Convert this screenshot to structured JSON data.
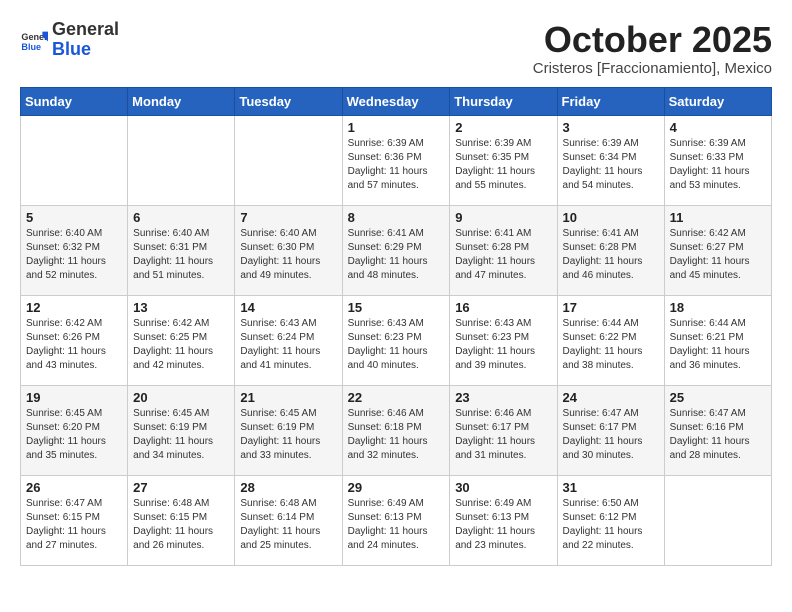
{
  "header": {
    "logo_general": "General",
    "logo_blue": "Blue",
    "month": "October 2025",
    "location": "Cristeros [Fraccionamiento], Mexico"
  },
  "days_of_week": [
    "Sunday",
    "Monday",
    "Tuesday",
    "Wednesday",
    "Thursday",
    "Friday",
    "Saturday"
  ],
  "weeks": [
    [
      {
        "day": "",
        "info": ""
      },
      {
        "day": "",
        "info": ""
      },
      {
        "day": "",
        "info": ""
      },
      {
        "day": "1",
        "info": "Sunrise: 6:39 AM\nSunset: 6:36 PM\nDaylight: 11 hours and 57 minutes."
      },
      {
        "day": "2",
        "info": "Sunrise: 6:39 AM\nSunset: 6:35 PM\nDaylight: 11 hours and 55 minutes."
      },
      {
        "day": "3",
        "info": "Sunrise: 6:39 AM\nSunset: 6:34 PM\nDaylight: 11 hours and 54 minutes."
      },
      {
        "day": "4",
        "info": "Sunrise: 6:39 AM\nSunset: 6:33 PM\nDaylight: 11 hours and 53 minutes."
      }
    ],
    [
      {
        "day": "5",
        "info": "Sunrise: 6:40 AM\nSunset: 6:32 PM\nDaylight: 11 hours and 52 minutes."
      },
      {
        "day": "6",
        "info": "Sunrise: 6:40 AM\nSunset: 6:31 PM\nDaylight: 11 hours and 51 minutes."
      },
      {
        "day": "7",
        "info": "Sunrise: 6:40 AM\nSunset: 6:30 PM\nDaylight: 11 hours and 49 minutes."
      },
      {
        "day": "8",
        "info": "Sunrise: 6:41 AM\nSunset: 6:29 PM\nDaylight: 11 hours and 48 minutes."
      },
      {
        "day": "9",
        "info": "Sunrise: 6:41 AM\nSunset: 6:28 PM\nDaylight: 11 hours and 47 minutes."
      },
      {
        "day": "10",
        "info": "Sunrise: 6:41 AM\nSunset: 6:28 PM\nDaylight: 11 hours and 46 minutes."
      },
      {
        "day": "11",
        "info": "Sunrise: 6:42 AM\nSunset: 6:27 PM\nDaylight: 11 hours and 45 minutes."
      }
    ],
    [
      {
        "day": "12",
        "info": "Sunrise: 6:42 AM\nSunset: 6:26 PM\nDaylight: 11 hours and 43 minutes."
      },
      {
        "day": "13",
        "info": "Sunrise: 6:42 AM\nSunset: 6:25 PM\nDaylight: 11 hours and 42 minutes."
      },
      {
        "day": "14",
        "info": "Sunrise: 6:43 AM\nSunset: 6:24 PM\nDaylight: 11 hours and 41 minutes."
      },
      {
        "day": "15",
        "info": "Sunrise: 6:43 AM\nSunset: 6:23 PM\nDaylight: 11 hours and 40 minutes."
      },
      {
        "day": "16",
        "info": "Sunrise: 6:43 AM\nSunset: 6:23 PM\nDaylight: 11 hours and 39 minutes."
      },
      {
        "day": "17",
        "info": "Sunrise: 6:44 AM\nSunset: 6:22 PM\nDaylight: 11 hours and 38 minutes."
      },
      {
        "day": "18",
        "info": "Sunrise: 6:44 AM\nSunset: 6:21 PM\nDaylight: 11 hours and 36 minutes."
      }
    ],
    [
      {
        "day": "19",
        "info": "Sunrise: 6:45 AM\nSunset: 6:20 PM\nDaylight: 11 hours and 35 minutes."
      },
      {
        "day": "20",
        "info": "Sunrise: 6:45 AM\nSunset: 6:19 PM\nDaylight: 11 hours and 34 minutes."
      },
      {
        "day": "21",
        "info": "Sunrise: 6:45 AM\nSunset: 6:19 PM\nDaylight: 11 hours and 33 minutes."
      },
      {
        "day": "22",
        "info": "Sunrise: 6:46 AM\nSunset: 6:18 PM\nDaylight: 11 hours and 32 minutes."
      },
      {
        "day": "23",
        "info": "Sunrise: 6:46 AM\nSunset: 6:17 PM\nDaylight: 11 hours and 31 minutes."
      },
      {
        "day": "24",
        "info": "Sunrise: 6:47 AM\nSunset: 6:17 PM\nDaylight: 11 hours and 30 minutes."
      },
      {
        "day": "25",
        "info": "Sunrise: 6:47 AM\nSunset: 6:16 PM\nDaylight: 11 hours and 28 minutes."
      }
    ],
    [
      {
        "day": "26",
        "info": "Sunrise: 6:47 AM\nSunset: 6:15 PM\nDaylight: 11 hours and 27 minutes."
      },
      {
        "day": "27",
        "info": "Sunrise: 6:48 AM\nSunset: 6:15 PM\nDaylight: 11 hours and 26 minutes."
      },
      {
        "day": "28",
        "info": "Sunrise: 6:48 AM\nSunset: 6:14 PM\nDaylight: 11 hours and 25 minutes."
      },
      {
        "day": "29",
        "info": "Sunrise: 6:49 AM\nSunset: 6:13 PM\nDaylight: 11 hours and 24 minutes."
      },
      {
        "day": "30",
        "info": "Sunrise: 6:49 AM\nSunset: 6:13 PM\nDaylight: 11 hours and 23 minutes."
      },
      {
        "day": "31",
        "info": "Sunrise: 6:50 AM\nSunset: 6:12 PM\nDaylight: 11 hours and 22 minutes."
      },
      {
        "day": "",
        "info": ""
      }
    ]
  ]
}
